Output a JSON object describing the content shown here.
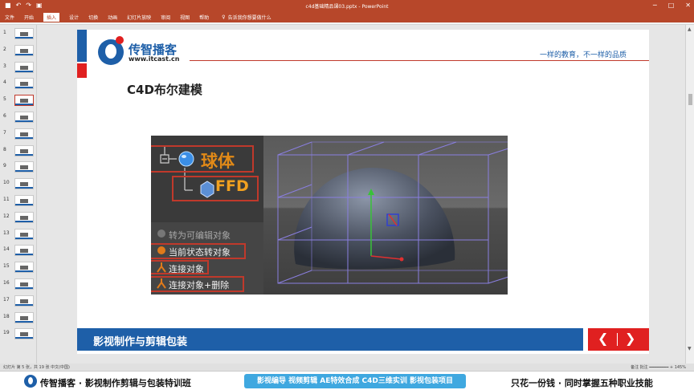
{
  "titlebar": {
    "doc_title": "c4d基础精品课03.pptx  -  PowerPoint",
    "undo_glyph": "↶",
    "redo_glyph": "↷",
    "start_glyph": "▣",
    "min_glyph": "─",
    "max_glyph": "□",
    "close_glyph": "✕"
  },
  "tabs": {
    "items": [
      "文件",
      "开始",
      "插入",
      "设计",
      "切换",
      "动画",
      "幻灯片放映",
      "审阅",
      "视图",
      "帮助"
    ],
    "active_index": 2,
    "tell_me": "告诉我你想要做什么",
    "bulb_glyph": "♀"
  },
  "thumbnails": {
    "numbers": [
      "1",
      "2",
      "3",
      "4",
      "5",
      "6",
      "7",
      "8",
      "9",
      "10",
      "11",
      "12",
      "13",
      "14",
      "15",
      "16",
      "17",
      "18",
      "19"
    ],
    "selected_index": 4
  },
  "slide": {
    "brand": "传智播客",
    "site": "www.itcast.cn",
    "slogan": "一样的教育，不一样的品质",
    "heading": "C4D布尔建模",
    "footer_title": "影视制作与剪辑包装",
    "prev_glyph": "❮",
    "next_glyph": "❯"
  },
  "c4d_image": {
    "tree_sphere": "球体",
    "tree_ffd": "FFD",
    "menu": [
      "转为可编辑对象",
      "当前状态转对象",
      "连接对象",
      "连接对象+删除"
    ]
  },
  "statusbar": {
    "left": "幻灯片 第 5 张，共 19 张    中文(中国)",
    "right": "备注  批注    ━━━━━━━━  +  145%"
  },
  "promo": {
    "left": "传智播客 · 影视制作剪辑与包装特训班",
    "middle": "影视编导  视频剪辑  AE特效合成  C4D三维实训  影视包装项目",
    "right": "只花一份钱 · 同时掌握五种职业技能"
  },
  "colors": {
    "ppt_red": "#b7472a",
    "brand_blue": "#1e5fa8",
    "accent_red": "#e02020",
    "annotation_red": "#c0392b",
    "c4d_orange": "#e28a17"
  }
}
